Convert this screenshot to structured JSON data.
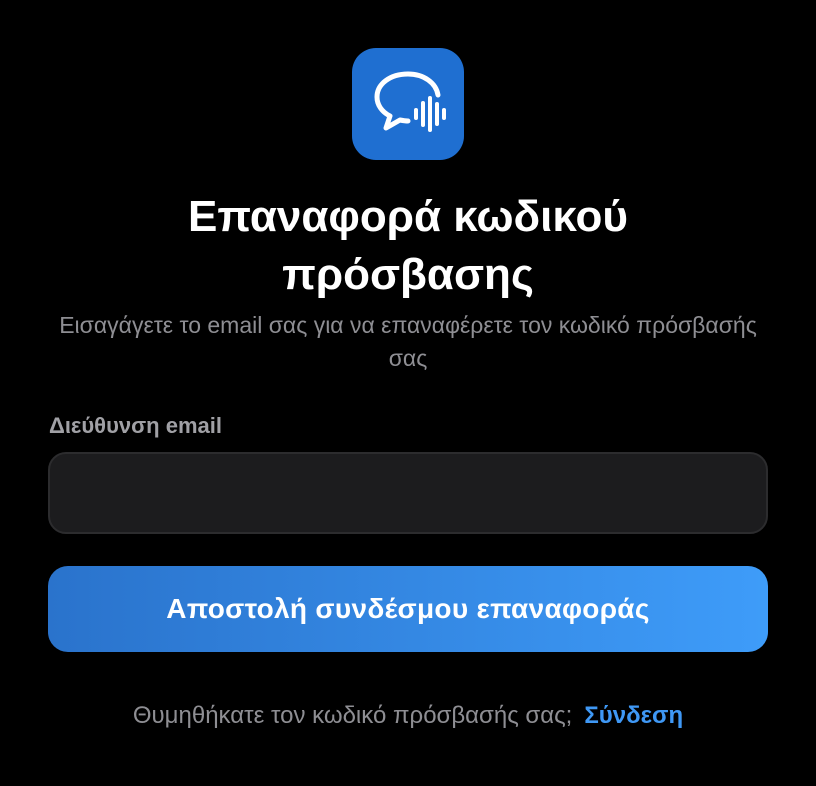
{
  "app": {
    "brand_color": "#1f6fd1",
    "logo_icon": "chat-bubble-soundwave-icon"
  },
  "header": {
    "title": "Επαναφορά κωδικού πρόσβασης",
    "subtitle": "Εισαγάγετε το email σας για να επαναφέρετε τον κωδικό πρόσβασής σας"
  },
  "form": {
    "email_label": "Διεύθυνση email",
    "email_value": "",
    "email_placeholder": "",
    "submit_label": "Αποστολή συνδέσμου επαναφοράς",
    "button_gradient": [
      "#2a73cc",
      "#3e9cf9"
    ]
  },
  "footer": {
    "prompt_text": "Θυμηθήκατε τον κωδικό πρόσβασής σας;",
    "login_link_label": "Σύνδεση",
    "link_color": "#3f98f5"
  }
}
